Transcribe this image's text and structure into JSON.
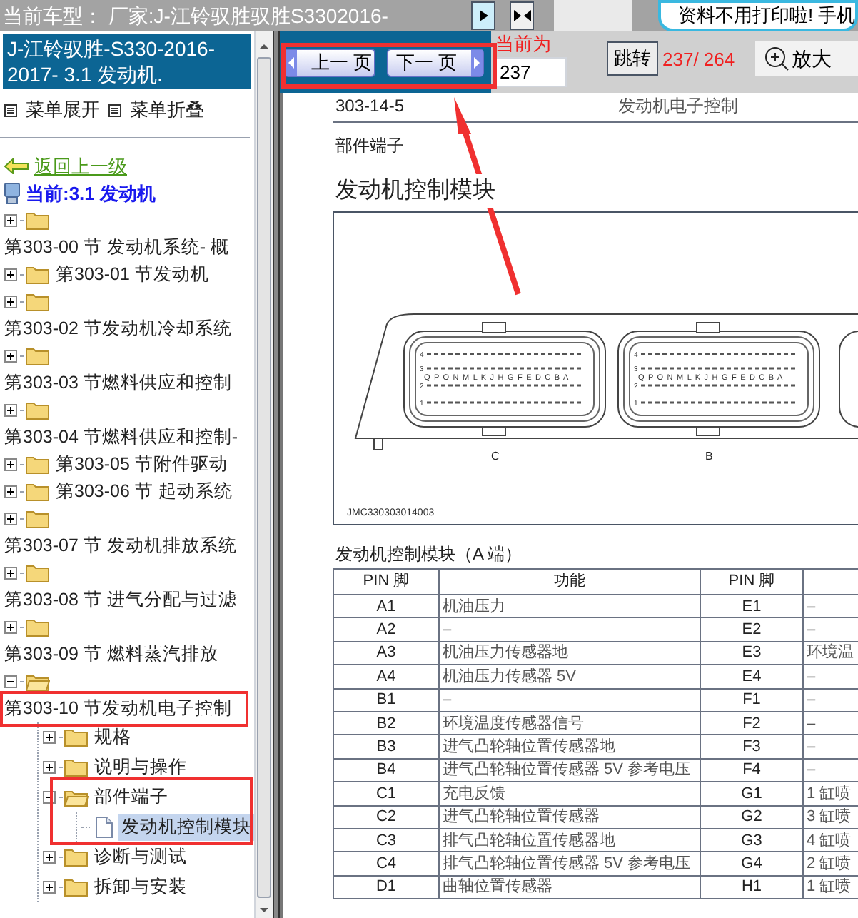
{
  "header": {
    "title": "当前车型： 厂家:J-江铃驭胜驭胜S3302016-",
    "banner_text": "资料不用打印啦! 手机"
  },
  "sidebar": {
    "model_title": "J-江铃驭胜-S330-2016-2017- 3.1 发动机.",
    "menu_actions": [
      "菜单展开",
      "菜单折叠"
    ],
    "back_link": "返回上一级",
    "current": "当前:3.1 发动机",
    "tree": [
      {
        "kind": "folder",
        "label": "第303-00 节 发动机系统- 概",
        "expanded": false,
        "selected": false
      },
      {
        "kind": "folder",
        "label": "第303-01 节发动机",
        "expanded": false,
        "selected": false
      },
      {
        "kind": "folder",
        "label": "第303-02 节发动机冷却系统",
        "expanded": false,
        "selected": false
      },
      {
        "kind": "folder",
        "label": "第303-03 节燃料供应和控制",
        "expanded": false,
        "selected": false
      },
      {
        "kind": "folder",
        "label": "第303-04 节燃料供应和控制-",
        "expanded": false,
        "selected": false
      },
      {
        "kind": "folder",
        "label": "第303-05 节附件驱动",
        "expanded": false,
        "selected": false
      },
      {
        "kind": "folder",
        "label": "第303-06 节 起动系统",
        "expanded": false,
        "selected": false
      },
      {
        "kind": "folder",
        "label": "第303-07 节 发动机排放系统",
        "expanded": false,
        "selected": false
      },
      {
        "kind": "folder",
        "label": "第303-08 节 进气分配与过滤",
        "expanded": false,
        "selected": false
      },
      {
        "kind": "folder",
        "label": "第303-09 节 燃料蒸汽排放",
        "expanded": false,
        "selected": false
      },
      {
        "kind": "folder",
        "label": "第303-10 节发动机电子控制",
        "expanded": true,
        "selected": false,
        "children": [
          {
            "kind": "folder",
            "label": "规格",
            "expanded": false,
            "selected": false
          },
          {
            "kind": "folder",
            "label": "说明与操作",
            "expanded": false,
            "selected": false
          },
          {
            "kind": "folder",
            "label": "部件端子",
            "expanded": true,
            "selected": false,
            "children": [
              {
                "kind": "document",
                "label": "发动机控制模块",
                "selected": true
              }
            ]
          },
          {
            "kind": "folder",
            "label": "诊断与测试",
            "expanded": false,
            "selected": false
          },
          {
            "kind": "folder",
            "label": "拆卸与安装",
            "expanded": false,
            "selected": false
          }
        ]
      }
    ]
  },
  "pager": {
    "prev": "上一 页",
    "next": "下一 页",
    "current_label": "当前为",
    "page_value": "237",
    "jump": "跳转",
    "page_count": "237/ 264",
    "zoom": "放大"
  },
  "document": {
    "page_number": "303-14-5",
    "section": "发动机电子控制",
    "subsection": "部件端子",
    "heading": "发动机控制模块",
    "figure": {
      "connectors": [
        {
          "label": "C",
          "pin_letters": "Q  P  O N M L K J H G F E D C B A",
          "row_numbers": [
            "4",
            "3",
            "2",
            "1"
          ]
        },
        {
          "label": "B",
          "pin_letters": "Q  P  O N M L K J H G F E D C B A",
          "row_numbers": [
            "4",
            "3",
            "2",
            "1"
          ]
        }
      ],
      "caption": "JMC330303014003"
    },
    "table_title": "发动机控制模块（A 端）",
    "table": {
      "columns": [
        "PIN 脚",
        "功能",
        "PIN 脚"
      ],
      "rows": [
        [
          "A1",
          "机油压力",
          "E1",
          "–"
        ],
        [
          "A2",
          "–",
          "E2",
          "–"
        ],
        [
          "A3",
          "机油压力传感器地",
          "E3",
          "环境温"
        ],
        [
          "A4",
          "机油压力传感器 5V",
          "E4",
          "–"
        ],
        [
          "B1",
          "–",
          "F1",
          "–"
        ],
        [
          "B2",
          "环境温度传感器信号",
          "F2",
          "–"
        ],
        [
          "B3",
          "进气凸轮轴位置传感器地",
          "F3",
          "–"
        ],
        [
          "B4",
          "进气凸轮轴位置传感器 5V 参考电压",
          "F4",
          "–"
        ],
        [
          "C1",
          "充电反馈",
          "G1",
          "1 缸喷"
        ],
        [
          "C2",
          "进气凸轮轴位置传感器",
          "G2",
          "3 缸喷"
        ],
        [
          "C3",
          "排气凸轮轴位置传感器地",
          "G3",
          "4 缸喷"
        ],
        [
          "C4",
          "排气凸轮轴位置传感器 5V 参考电压",
          "G4",
          "2 缸喷"
        ],
        [
          "D1",
          "曲轴位置传感器",
          "H1",
          "1 缸喷"
        ]
      ]
    }
  }
}
